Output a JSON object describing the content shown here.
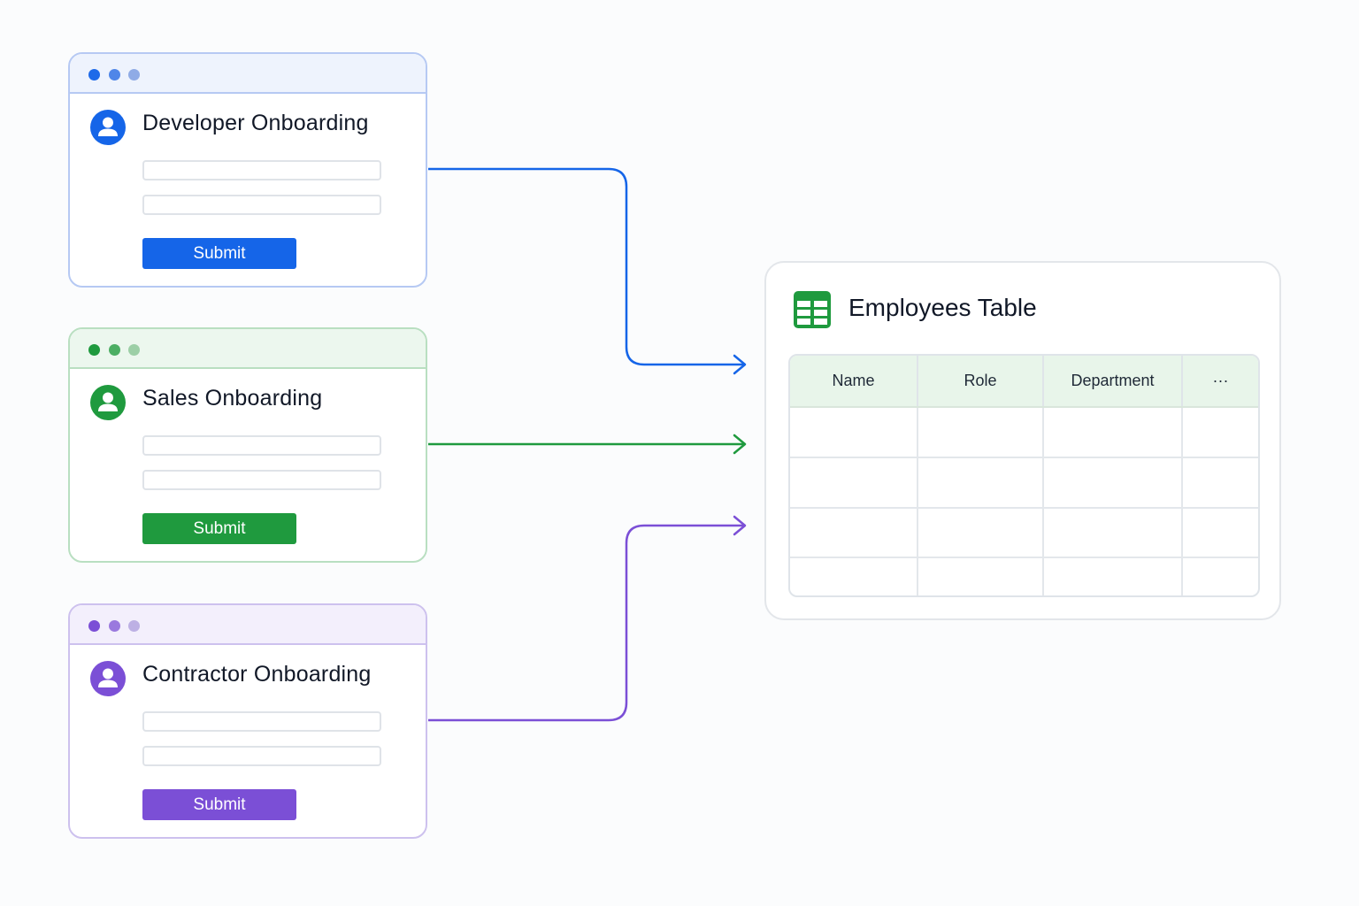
{
  "forms": [
    {
      "id": "developer",
      "title": "Developer Onboarding",
      "submit_label": "Submit",
      "accent": "#1565e8",
      "border": "#b6c9f3",
      "header_bg": "#eef3fd",
      "dot_colors": [
        "#1e6ae9",
        "#4f86e8",
        "#8fabe6"
      ],
      "avatar_icon": "user-icon"
    },
    {
      "id": "sales",
      "title": "Sales Onboarding",
      "submit_label": "Submit",
      "accent": "#1f9a3e",
      "border": "#b9dfc1",
      "header_bg": "#ecf7ee",
      "dot_colors": [
        "#1f9a3e",
        "#4cae63",
        "#9ccfa6"
      ],
      "avatar_icon": "user-icon"
    },
    {
      "id": "contractor",
      "title": "Contractor Onboarding",
      "submit_label": "Submit",
      "accent": "#7b4fd6",
      "border": "#cdc1ee",
      "header_bg": "#f3effc",
      "dot_colors": [
        "#7b4fd6",
        "#9a79de",
        "#bdb0e4"
      ],
      "avatar_icon": "user-icon"
    }
  ],
  "table": {
    "title": "Employees Table",
    "icon": "spreadsheet-icon",
    "icon_color": "#1f9a3e",
    "columns": [
      "Name",
      "Role",
      "Department",
      "···"
    ],
    "row_count": 4
  },
  "connectors": [
    {
      "from": "developer",
      "color": "#1565e8"
    },
    {
      "from": "sales",
      "color": "#1f9a3e"
    },
    {
      "from": "contractor",
      "color": "#7b4fd6"
    }
  ]
}
